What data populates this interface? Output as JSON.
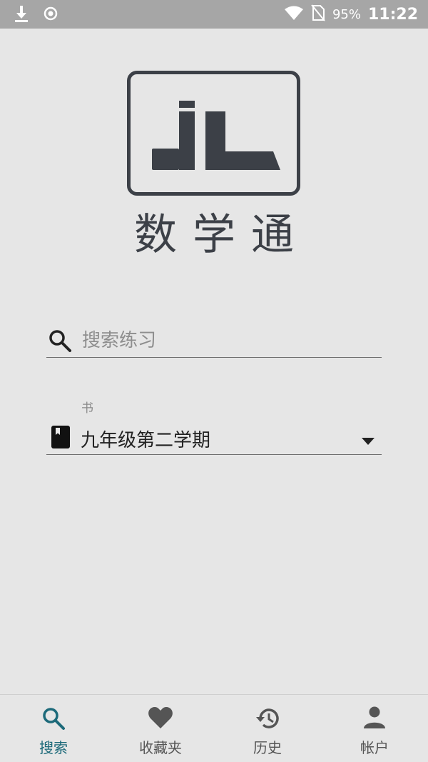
{
  "status_bar": {
    "battery": "95%",
    "time": "11:22"
  },
  "logo": {
    "title": "数学通",
    "mark_text": "JL"
  },
  "search": {
    "placeholder": "搜索练习",
    "value": ""
  },
  "book": {
    "label": "书",
    "selected": "九年级第二学期"
  },
  "bottom_nav": {
    "items": [
      {
        "label": "搜索",
        "icon": "search-icon",
        "active": true
      },
      {
        "label": "收藏夹",
        "icon": "heart-icon",
        "active": false
      },
      {
        "label": "历史",
        "icon": "history-icon",
        "active": false
      },
      {
        "label": "帐户",
        "icon": "account-icon",
        "active": false
      }
    ]
  },
  "colors": {
    "background": "#e6e6e6",
    "status_bar": "#a6a6a6",
    "logo": "#3c4047",
    "accent": "#1d6a7a"
  }
}
